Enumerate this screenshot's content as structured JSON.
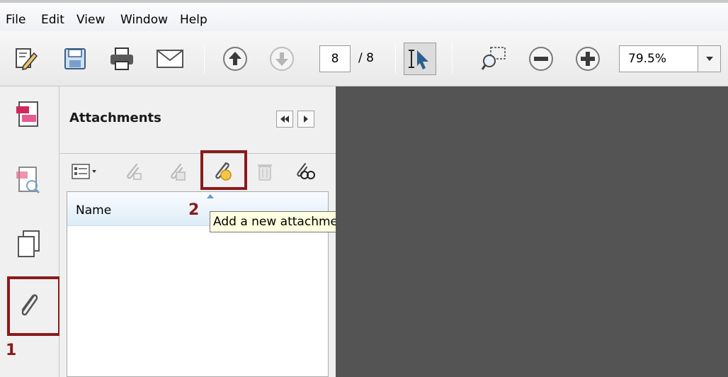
{
  "menu": {
    "items": [
      "File",
      "Edit",
      "View",
      "Window",
      "Help"
    ]
  },
  "toolbar": {
    "page_current": "8",
    "page_total": "/ 8",
    "zoom_value": "79.5%"
  },
  "panel": {
    "title": "Attachments",
    "list_header": "Name"
  },
  "tooltip": {
    "text": "Add a new attachment"
  },
  "annotations": {
    "step1": "1",
    "step2": "2"
  },
  "colors": {
    "highlight": "#8b1a1a",
    "document_bg": "#545454",
    "tooltip_bg": "#ffffe1"
  },
  "icons": {
    "toolbar": [
      "edit-document-icon",
      "save-icon",
      "print-icon",
      "email-icon",
      "previous-page-icon",
      "next-page-icon",
      "select-tool-icon",
      "marquee-zoom-icon",
      "zoom-out-icon",
      "zoom-in-icon",
      "chevron-down-icon"
    ],
    "rail": [
      "pages-icon",
      "signatures-icon",
      "layers-icon",
      "paperclip-icon"
    ],
    "panel_toolbar": [
      "options-menu-icon",
      "open-attachment-icon",
      "save-attachment-icon",
      "add-attachment-icon",
      "delete-icon",
      "search-attachments-icon"
    ]
  }
}
